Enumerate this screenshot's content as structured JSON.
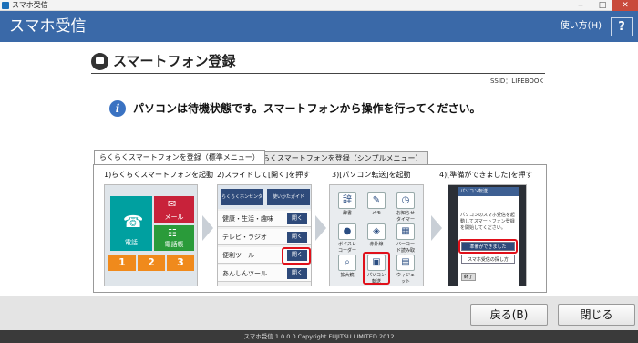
{
  "window": {
    "title": "スマホ受信",
    "minimize": "‒",
    "maximize": "□",
    "close": "✕"
  },
  "header": {
    "app_title": "スマホ受信",
    "help_label": "使い方(H)",
    "help_button": "?"
  },
  "section": {
    "title": "スマートフォン登録",
    "ssid": "SSID：LIFEBOOK"
  },
  "message": {
    "icon": "i",
    "text": "パソコンは待機状態です。スマートフォンから操作を行ってください。"
  },
  "tabs": [
    {
      "label": "らくらくスマートフォンを登録（標準メニュー）",
      "active": true
    },
    {
      "label": "らくらくスマートフォンを登録（シンプルメニュー）",
      "active": false
    }
  ],
  "steps": [
    {
      "label": "1)らくらくスマートフォンを起動"
    },
    {
      "label": "2)スライドして[開く]を押す"
    },
    {
      "label": "3)[パソコン転送]を起動"
    },
    {
      "label": "4)[準備ができました]を押す"
    }
  ],
  "step1": {
    "phone_tile": "電話",
    "mail_tile": "メール",
    "book_tile": "電話帳",
    "numbers": [
      "1",
      "2",
      "3"
    ]
  },
  "step2": {
    "chips": [
      "らくらくホンセンター",
      "使いかたガイド"
    ],
    "rows": [
      "健康・生活・趣味",
      "テレビ・ラジオ",
      "便利ツール",
      "あんしんツール"
    ],
    "open_label": "開く"
  },
  "step3": {
    "apps": [
      "辞書",
      "メモ",
      "お知らせタイマー",
      "ボイスレコーダー",
      "赤外線",
      "バーコード読み取り",
      "拡大鏡",
      "パソコン転送",
      "ウィジェット"
    ]
  },
  "step4": {
    "screen_title": "パソコン転送",
    "instruction": "パソコンのスマホ受信を起動してスマートフォン登録を開始してください。",
    "ready_button": "準備ができました",
    "how_button": "スマホ受信の探し方",
    "end_button": "終了"
  },
  "buttons": {
    "back": "戻る(B)",
    "close": "閉じる"
  },
  "footer": {
    "text": "スマホ受信 1.0.0.0  Copyright FUJITSU LIMITED 2012"
  },
  "colors": {
    "header_bg": "#3a69a8",
    "highlight": "#e0101a",
    "footer_bg": "#3a3a3a"
  }
}
